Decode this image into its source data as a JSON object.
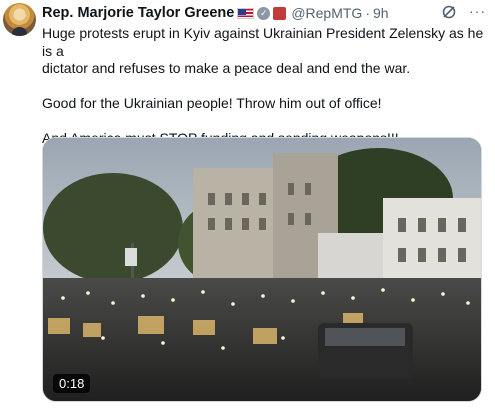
{
  "tweet": {
    "author_name": "Rep. Marjorie Taylor Greene",
    "handle": "@RepMTG",
    "separator": "·",
    "time": "9h",
    "more_label": "···",
    "text_lines": [
      "Huge protests erupt in Kyiv against Ukrainian President Zelensky as he is a",
      "dictator and refuses to make a peace deal and end the war."
    ],
    "text_para2": "Good for the Ukrainian people! Throw him out of office!",
    "text_para3": "And America must STOP funding and sending weapons!!!",
    "video_duration": "0:18"
  },
  "icons": {
    "flag": "us-flag-icon",
    "verified": "verified-badge-icon",
    "government": "government-badge-icon",
    "grok": "grok-icon",
    "more": "more-icon"
  }
}
